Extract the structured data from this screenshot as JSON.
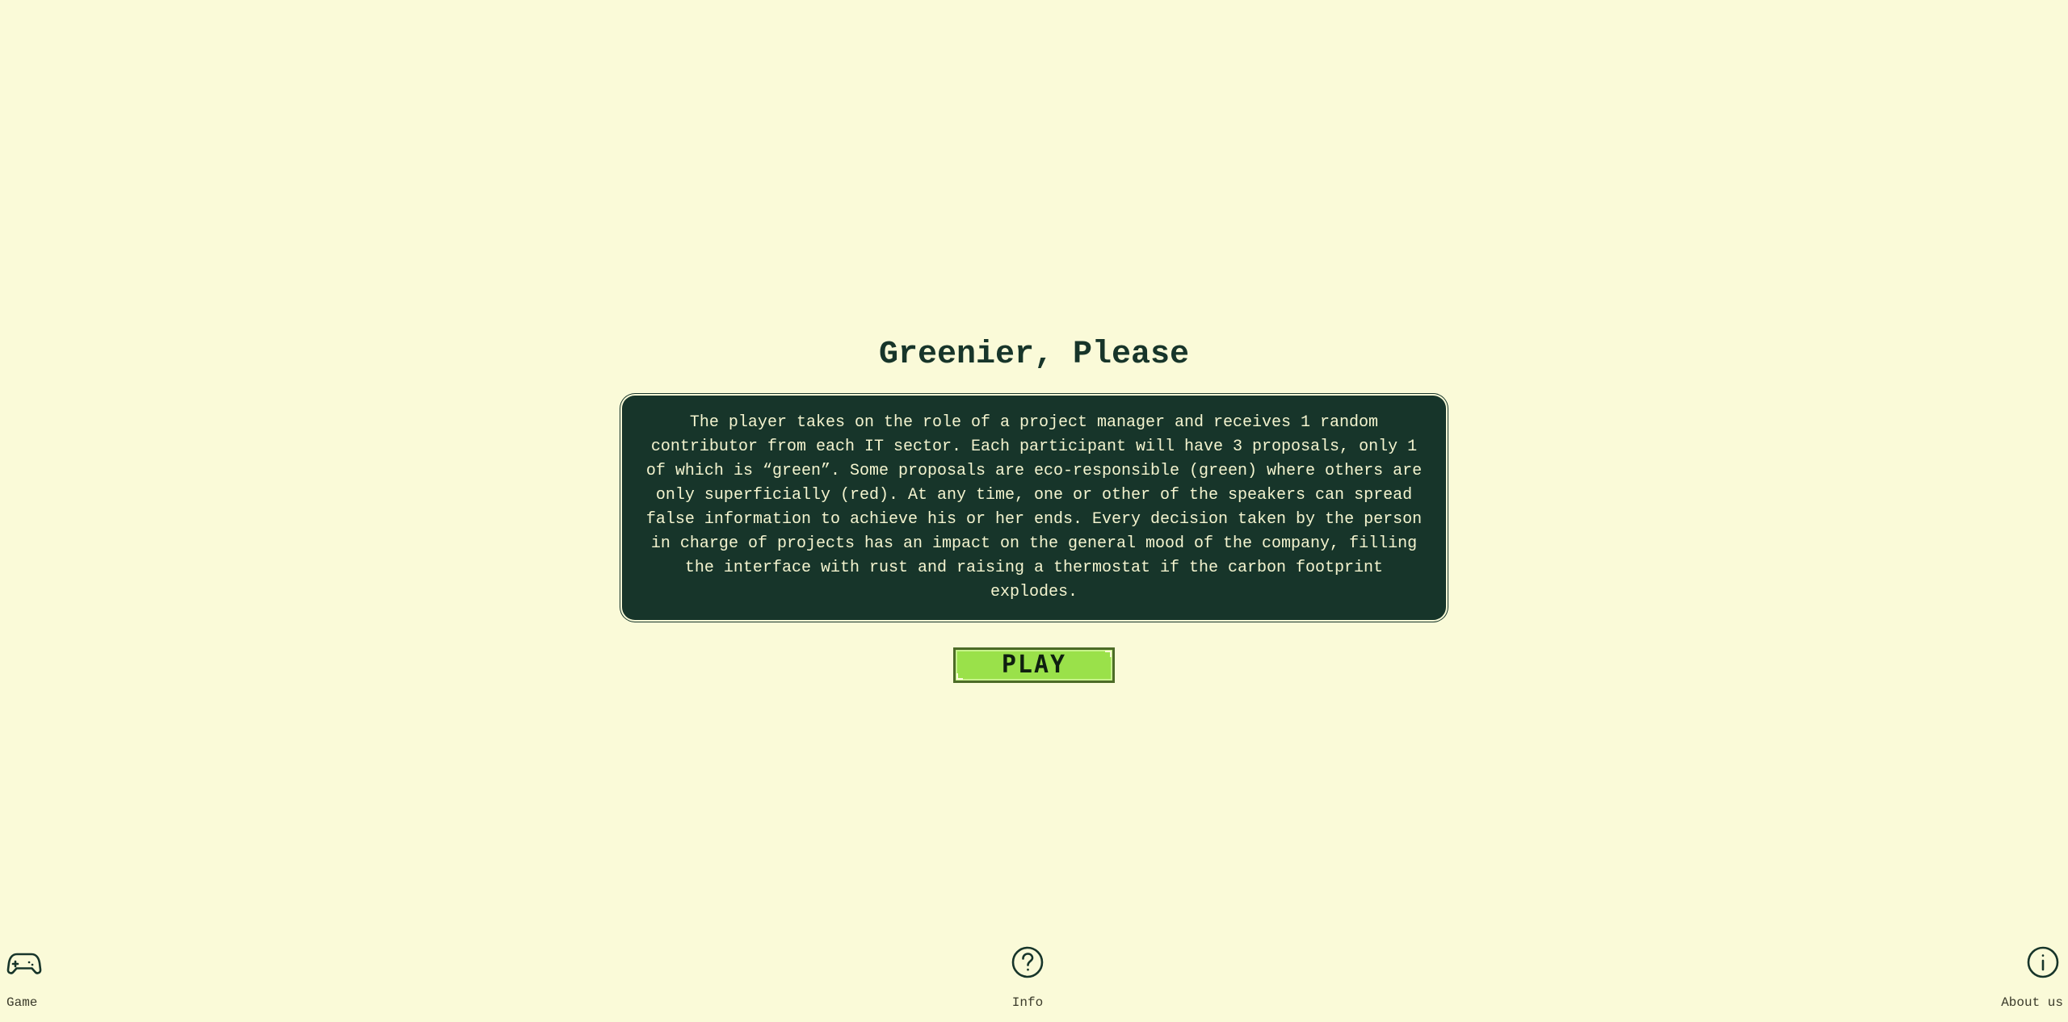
{
  "title": "Greenier, Please",
  "description": "The player takes on the role of a project manager and receives 1 random contributor from each IT sector. Each participant will have 3 proposals, only 1 of which is “green”. Some proposals are eco-responsible (green) where others are only superficially (red). At any time, one or other of the speakers can spread false information to achieve his or her ends. Every decision taken by the person in charge of projects has an impact on the general mood of the company, filling the interface with rust and raising a thermostat if the carbon footprint explodes.",
  "play_button": "PLAY",
  "bottom_nav": {
    "game": {
      "label": "Game",
      "icon": "gamepad-icon"
    },
    "info": {
      "label": "Info",
      "icon": "question-circle-icon"
    },
    "about": {
      "label": "About us",
      "icon": "info-circle-icon"
    }
  },
  "colors": {
    "background": "#fafad8",
    "dark_green": "#17352a",
    "accent_green": "#9ae14a"
  }
}
